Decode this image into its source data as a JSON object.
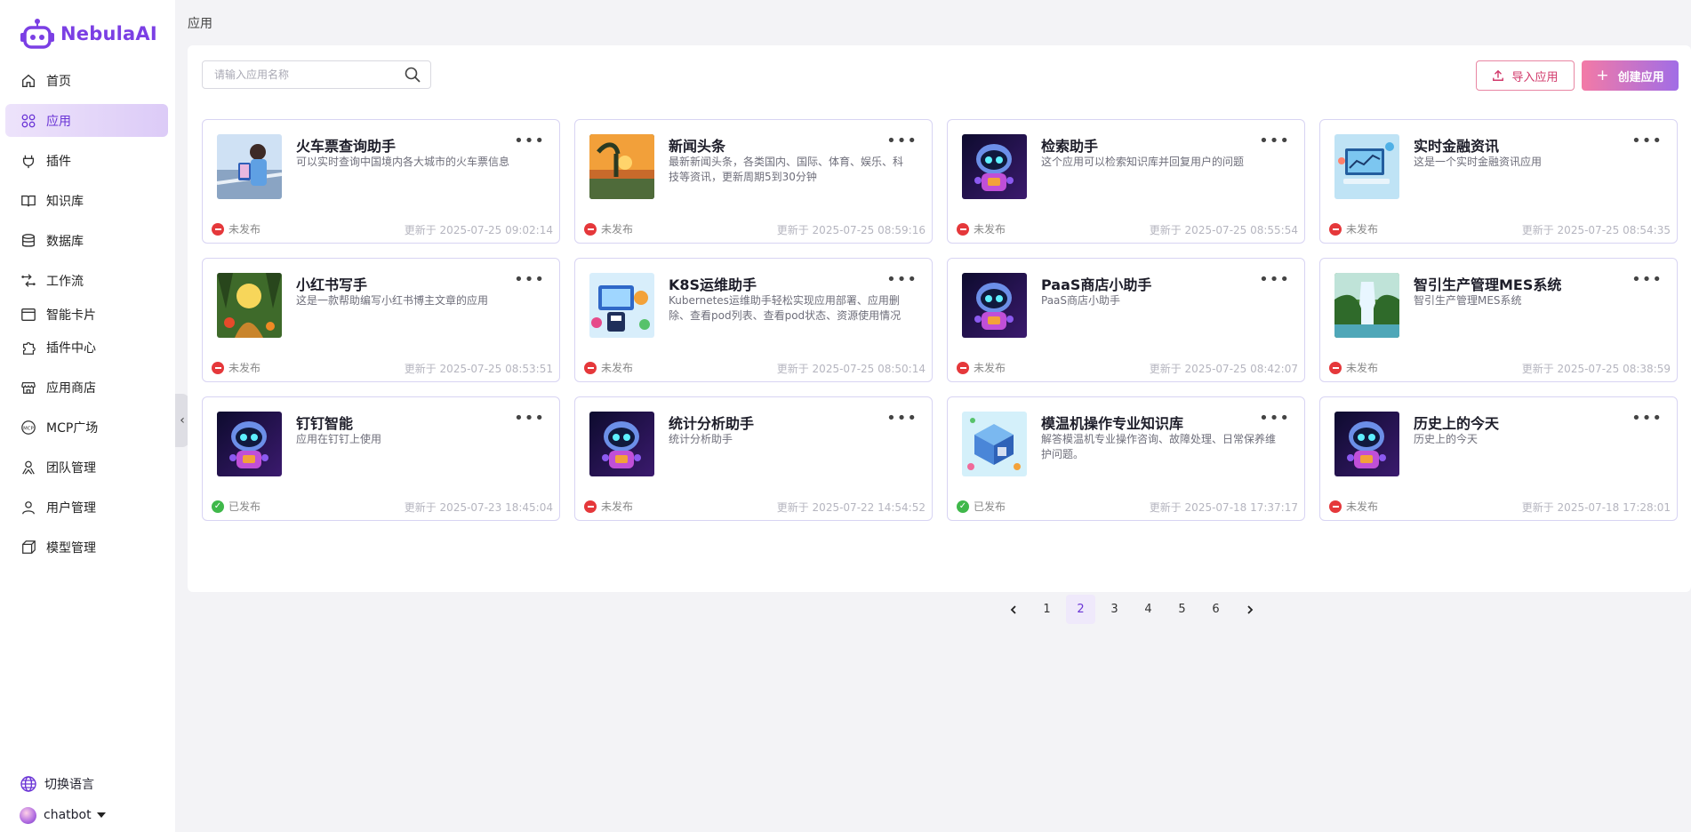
{
  "brand": {
    "name": "NebulaAI",
    "color": "#7b3fe4"
  },
  "nav": [
    {
      "label": "首页",
      "icon": "home-icon",
      "active": false
    },
    {
      "label": "应用",
      "icon": "apps-icon",
      "active": true
    },
    {
      "label": "插件",
      "icon": "plug-icon",
      "active": false
    },
    {
      "label": "知识库",
      "icon": "book-icon",
      "active": false
    },
    {
      "label": "数据库",
      "icon": "database-icon",
      "active": false
    },
    {
      "label": "工作流",
      "icon": "workflow-icon",
      "active": false
    },
    {
      "label": "智能卡片",
      "icon": "card-icon",
      "active": false
    },
    {
      "label": "插件中心",
      "icon": "puzzle-icon",
      "active": false
    },
    {
      "label": "应用商店",
      "icon": "store-icon",
      "active": false
    },
    {
      "label": "MCP广场",
      "icon": "mcp-icon",
      "active": false
    },
    {
      "label": "团队管理",
      "icon": "team-icon",
      "active": false
    },
    {
      "label": "用户管理",
      "icon": "user-icon",
      "active": false
    },
    {
      "label": "模型管理",
      "icon": "cube-icon",
      "active": false
    }
  ],
  "footer": {
    "language_label": "切换语言",
    "username": "chatbot"
  },
  "breadcrumb": "应用",
  "search": {
    "placeholder": "请输入应用名称",
    "value": ""
  },
  "actions": {
    "import_label": "导入应用",
    "create_label": "创建应用"
  },
  "apps": [
    {
      "title": "火车票查询助手",
      "desc": "可以实时查询中国境内各大城市的火车票信息",
      "status": "未发布",
      "published": false,
      "updated": "更新于 2025-07-25 09:02:14",
      "thumb": "train"
    },
    {
      "title": "新闻头条",
      "desc": "最新新闻头条，各类国内、国际、体育、娱乐、科技等资讯，更新周期5到30分钟",
      "status": "未发布",
      "published": false,
      "updated": "更新于 2025-07-25 08:59:16",
      "thumb": "sunset"
    },
    {
      "title": "检索助手",
      "desc": "这个应用可以检索知识库并回复用户的问题",
      "status": "未发布",
      "published": false,
      "updated": "更新于 2025-07-25 08:55:54",
      "thumb": "robot"
    },
    {
      "title": "实时金融资讯",
      "desc": "这是一个实时金融资讯应用",
      "status": "未发布",
      "published": false,
      "updated": "更新于 2025-07-25 08:54:35",
      "thumb": "finance"
    },
    {
      "title": "小红书写手",
      "desc": "这是一款帮助编写小红书博主文章的应用",
      "status": "未发布",
      "published": false,
      "updated": "更新于 2025-07-25 08:53:51",
      "thumb": "forest"
    },
    {
      "title": "K8S运维助手",
      "desc": "Kubernetes运维助手轻松实现应用部署、应用删除、查看pod列表、查看pod状态、资源使用情况",
      "status": "未发布",
      "published": false,
      "updated": "更新于 2025-07-25 08:50:14",
      "thumb": "k8s"
    },
    {
      "title": "PaaS商店小助手",
      "desc": "PaaS商店小助手",
      "status": "未发布",
      "published": false,
      "updated": "更新于 2025-07-25 08:42:07",
      "thumb": "robot"
    },
    {
      "title": "智引生产管理MES系统",
      "desc": "智引生产管理MES系统",
      "status": "未发布",
      "published": false,
      "updated": "更新于 2025-07-25 08:38:59",
      "thumb": "waterfall"
    },
    {
      "title": "钉钉智能",
      "desc": "应用在钉钉上使用",
      "status": "已发布",
      "published": true,
      "updated": "更新于 2025-07-23 18:45:04",
      "thumb": "robot"
    },
    {
      "title": "统计分析助手",
      "desc": "统计分析助手",
      "status": "未发布",
      "published": false,
      "updated": "更新于 2025-07-22 14:54:52",
      "thumb": "robot"
    },
    {
      "title": "模温机操作专业知识库",
      "desc": "解答模温机专业操作咨询、故障处理、日常保养维护问题。",
      "status": "已发布",
      "published": true,
      "updated": "更新于 2025-07-18 17:37:17",
      "thumb": "iso"
    },
    {
      "title": "历史上的今天",
      "desc": "历史上的今天",
      "status": "未发布",
      "published": false,
      "updated": "更新于 2025-07-18 17:28:01",
      "thumb": "robot"
    }
  ],
  "pagination": {
    "pages": [
      "1",
      "2",
      "3",
      "4",
      "5",
      "6"
    ],
    "current": "2"
  },
  "colors": {
    "accent": "#7b3fe4",
    "danger": "#e5383b",
    "success": "#3fb84a"
  }
}
